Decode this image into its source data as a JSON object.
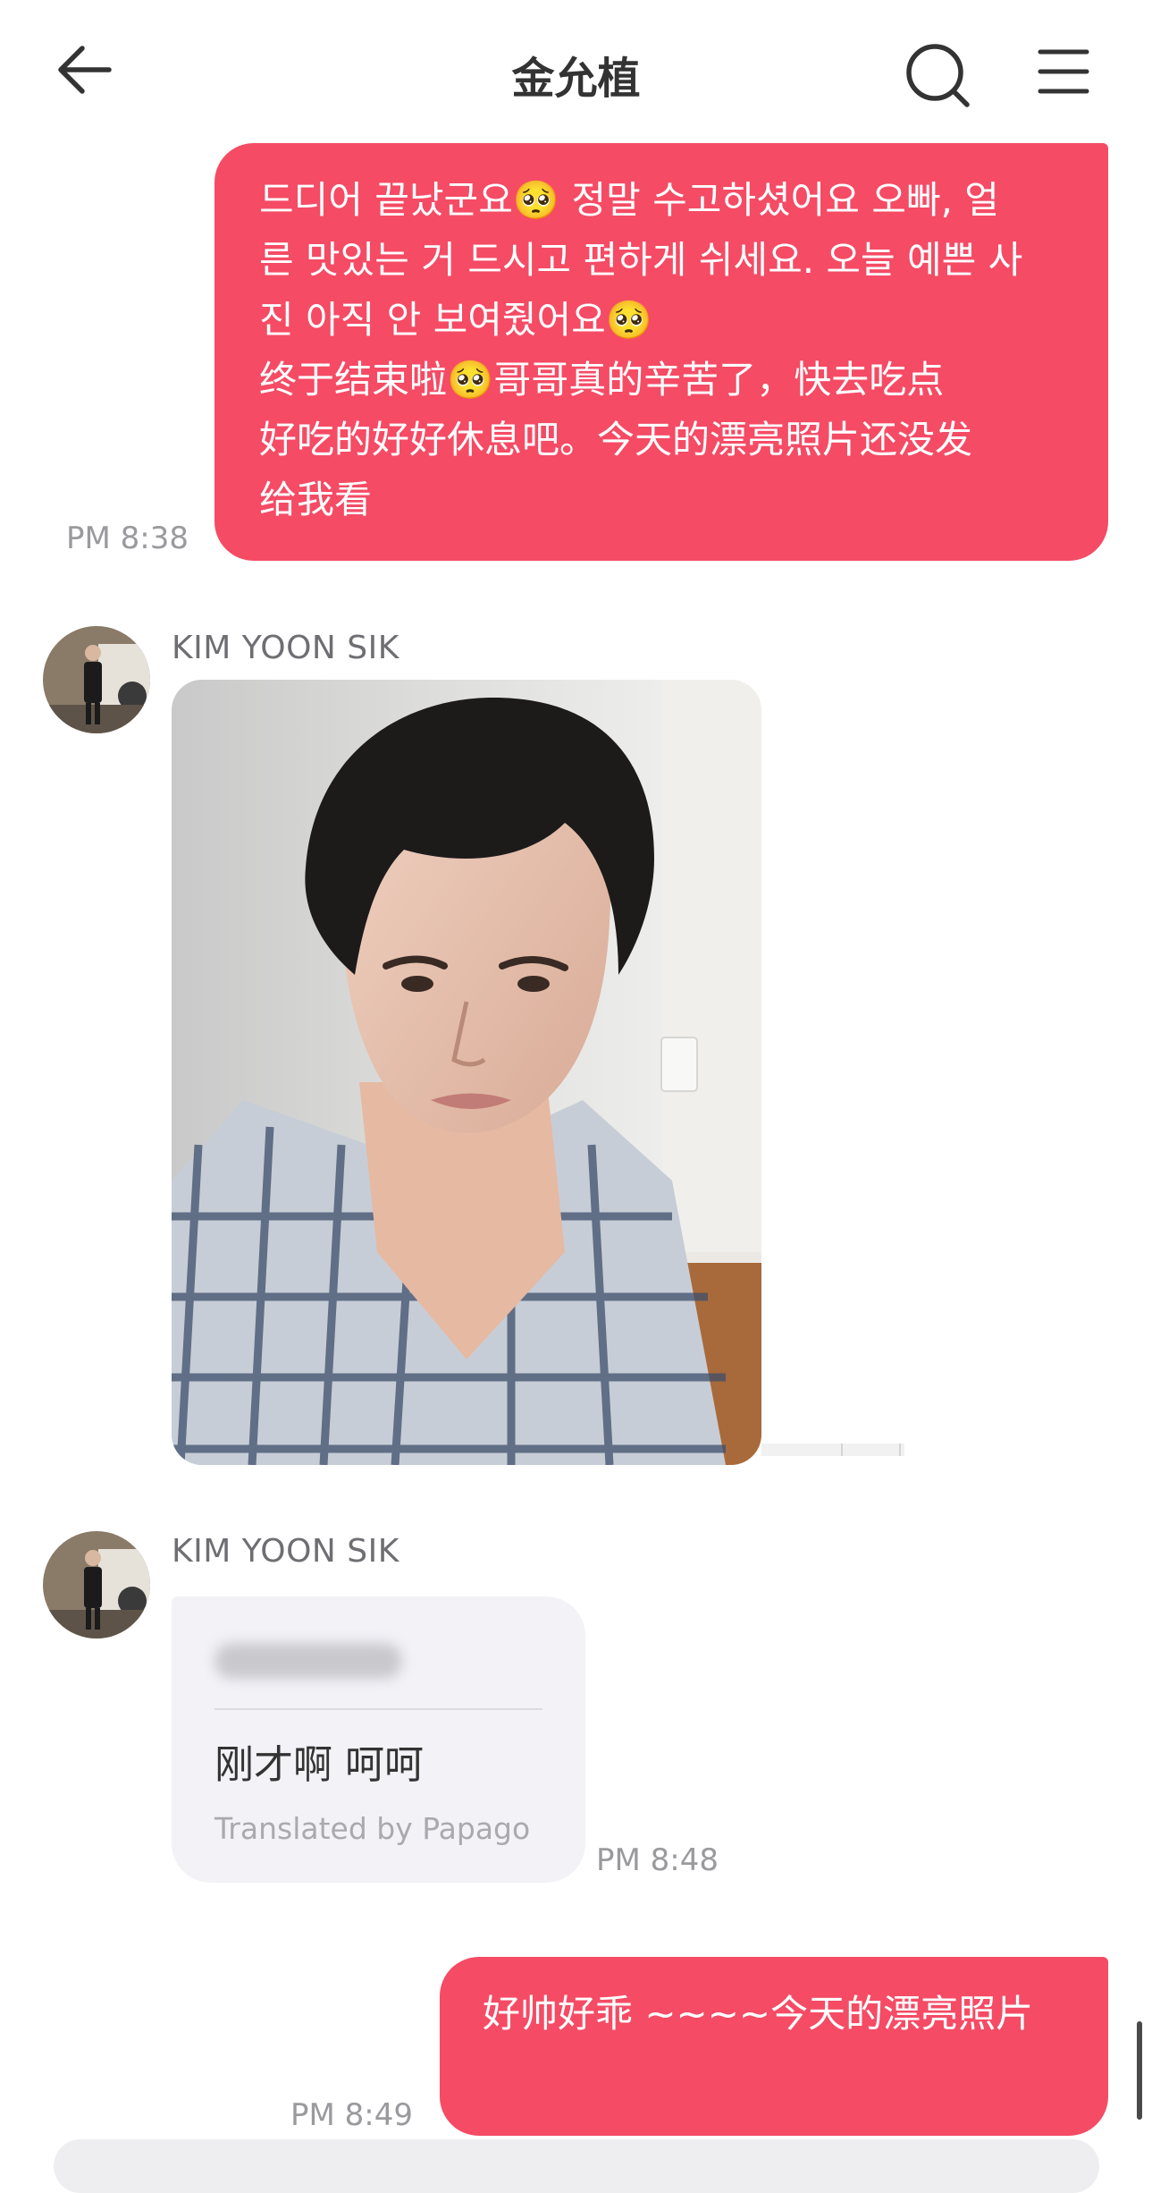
{
  "header": {
    "title": "金允植",
    "back_icon": "arrow-left-icon",
    "search_icon": "search-icon",
    "menu_icon": "hamburger-menu-icon"
  },
  "messages": {
    "out1": {
      "line1": "드디어 끝났군요🥺 정말 수고하셨어요 오빠, 얼",
      "line2": "른 맛있는 거 드시고 편하게 쉬세요. 오늘 예쁜 사",
      "line3": "진 아직 안 보여줬어요🥺",
      "line4": "终于结束啦🥺哥哥真的辛苦了，快去吃点",
      "line5": "好吃的好好休息吧。今天的漂亮照片还没发",
      "line6": "给我看",
      "time": "PM 8:38"
    },
    "in1": {
      "sender": "KIM YOON SIK",
      "type": "photo"
    },
    "in2": {
      "sender": "KIM YOON SIK",
      "translated_text": "刚才啊 呵呵",
      "translation_credit": "Translated by Papago",
      "time": "PM 8:48"
    },
    "out2": {
      "text": "好帅好乖 ~~~~今天的漂亮照片",
      "time": "PM 8:49"
    }
  },
  "colors": {
    "outgoing_bubble": "#f54b65",
    "incoming_bubble": "#f2f2f7",
    "timestamp": "#9a9a9e"
  }
}
